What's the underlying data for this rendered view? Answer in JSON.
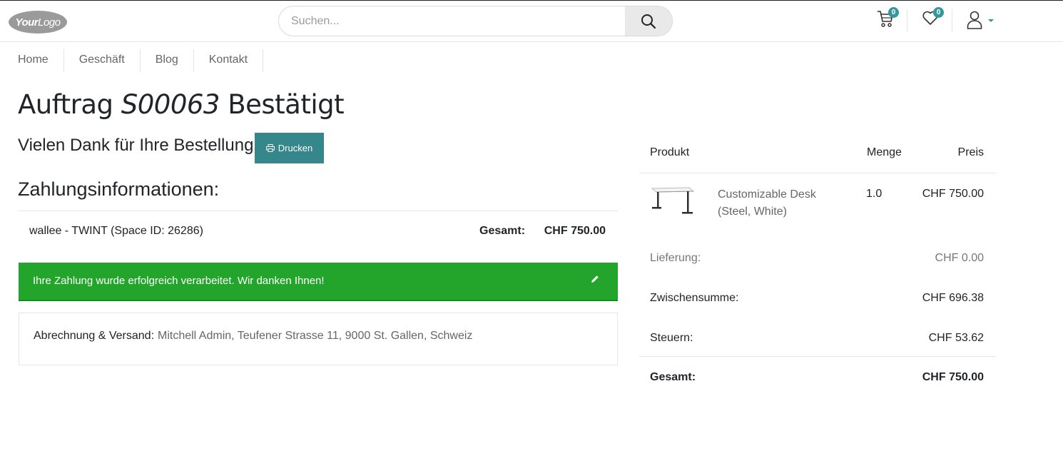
{
  "header": {
    "logo_text": "YourLogo",
    "search_placeholder": "Suchen...",
    "cart_count": "0",
    "wishlist_count": "0"
  },
  "nav": {
    "items": [
      "Home",
      "Geschäft",
      "Blog",
      "Kontakt"
    ]
  },
  "order": {
    "title_prefix": "Auftrag",
    "number": "S00063",
    "title_suffix": "Bestätigt",
    "thanks": "Vielen Dank für Ihre Bestellung",
    "print_label": "Drucken"
  },
  "payment": {
    "heading": "Zahlungsinformationen:",
    "method": "wallee - TWINT (Space ID: 26286)",
    "total_label": "Gesamt:",
    "total_value": "CHF 750.00",
    "success_message": "Ihre Zahlung wurde erfolgreich verarbeitet. Wir danken Ihnen!"
  },
  "address": {
    "label": "Abrechnung & Versand:",
    "value": "Mitchell Admin, Teufener Strasse 11, 9000 St. Gallen, Schweiz"
  },
  "summary": {
    "col_product": "Produkt",
    "col_qty": "Menge",
    "col_price": "Preis",
    "product_name": "Customizable Desk (Steel, White)",
    "product_qty": "1.0",
    "product_price": "CHF 750.00",
    "shipping_label": "Lieferung:",
    "shipping_value": "CHF 0.00",
    "subtotal_label": "Zwischensumme:",
    "subtotal_value": "CHF 696.38",
    "tax_label": "Steuern:",
    "tax_value": "CHF 53.62",
    "total_label": "Gesamt:",
    "total_value": "CHF 750.00"
  },
  "colors": {
    "accent": "#35979c",
    "print_button": "#35878b",
    "success": "#23a42b"
  },
  "icons": {
    "search": "search-icon",
    "cart": "cart-icon",
    "wishlist": "heart-icon",
    "user": "user-icon",
    "print": "printer-icon",
    "edit": "pencil-icon"
  }
}
